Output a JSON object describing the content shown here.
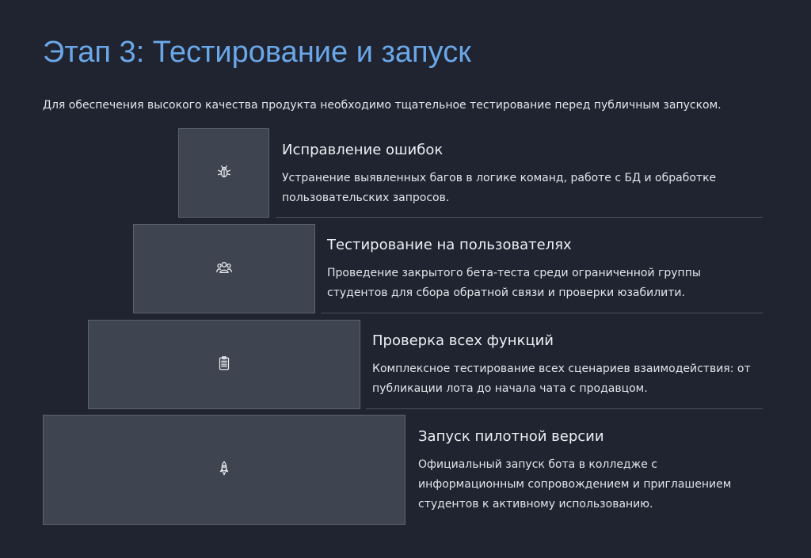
{
  "header": {
    "title": "Этап 3: Тестирование и запуск",
    "subtitle": "Для обеспечения высокого качества продукта необходимо тщательное тестирование перед публичным запуском."
  },
  "steps": [
    {
      "title": "Исправление ошибок",
      "description": "Устранение выявленных багов в логике команд, работе с БД и обработке пользовательских запросов.",
      "icon": "bug-icon"
    },
    {
      "title": "Тестирование на пользователях",
      "description": "Проведение закрытого бета-теста среди ограниченной группы студентов для сбора обратной связи и проверки юзабилити.",
      "icon": "users-icon"
    },
    {
      "title": "Проверка всех функций",
      "description": "Комплексное тестирование всех сценариев взаимодействия: от публикации лота до начала чата с продавцом.",
      "icon": "clipboard-icon"
    },
    {
      "title": "Запуск пилотной версии",
      "description": "Официальный запуск бота в колледже с информационным сопровождением и приглашением студентов к активному использованию.",
      "icon": "rocket-icon"
    }
  ],
  "colors": {
    "background": "#1f2430",
    "title": "#6ba7e8",
    "block": "#3e4450",
    "block_border": "#5b6270",
    "text": "#e2e5ea"
  }
}
